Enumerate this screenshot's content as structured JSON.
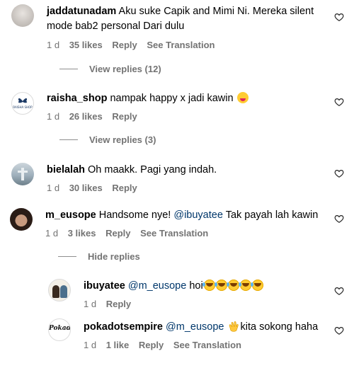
{
  "comments": [
    {
      "username": "jaddatunadam",
      "text_line1": "Aku suke Capik and Mimi Ni. Mereka silent",
      "text_line2": "mode bab2 personal Dari dulu",
      "time": "1 d",
      "likes": "35 likes",
      "reply": "Reply",
      "translate": "See Translation",
      "replies_toggle": "View replies (12)"
    },
    {
      "username": "raisha_shop",
      "text": "nampak happy x jadi kawin",
      "time": "1 d",
      "likes": "26 likes",
      "reply": "Reply",
      "replies_toggle": "View replies (3)",
      "avatar_text": "RAISHA SHOP"
    },
    {
      "username": "bielalah",
      "text": "Oh maakk. Pagi yang indah.",
      "time": "1 d",
      "likes": "30 likes",
      "reply": "Reply"
    },
    {
      "username": "m_eusope",
      "text": "Handsome nye!",
      "mention": "@ibuyatee",
      "text_after": "Tak payah lah kawin",
      "time": "1 d",
      "likes": "3 likes",
      "reply": "Reply",
      "translate": "See Translation",
      "replies_toggle": "Hide replies"
    }
  ],
  "replies": [
    {
      "username": "ibuyatee",
      "mention": "@m_eusope",
      "text": "hoi",
      "emoji": [
        "laughing-emoji",
        "laughing-emoji",
        "laughing-emoji",
        "laughing-emoji",
        "laughing-emoji"
      ],
      "time": "1 d",
      "reply": "Reply"
    },
    {
      "username": "pokadotsempire",
      "mention": "@m_eusope",
      "emoji": [
        "clapping-hands-emoji"
      ],
      "text": "kita sokong haha",
      "time": "1 d",
      "likes": "1 like",
      "reply": "Reply",
      "translate": "See Translation",
      "avatar_text": "Pokad"
    }
  ],
  "colors": {
    "text": "#000000",
    "meta": "#737373",
    "mention": "#00376b",
    "background": "#ffffff"
  }
}
